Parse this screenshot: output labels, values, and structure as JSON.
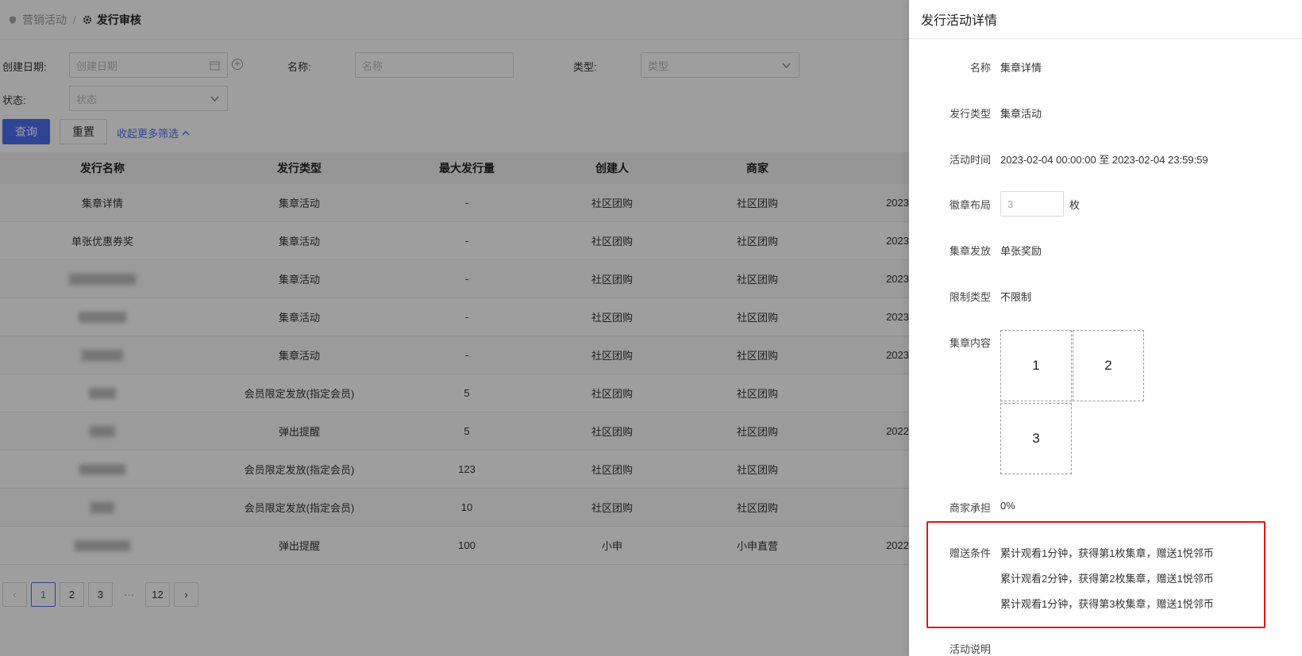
{
  "breadcrumb": {
    "parent": "营销活动",
    "current": "发行审核"
  },
  "filters": {
    "create_date_label": "创建日期:",
    "create_date_placeholder": "创建日期",
    "name_label": "名称:",
    "name_placeholder": "名称",
    "type_label": "类型:",
    "type_placeholder": "类型",
    "status_label": "状态:",
    "status_placeholder": "状态",
    "query_button": "查询",
    "reset_button": "重置",
    "collapse_link": "收起更多筛选"
  },
  "table": {
    "headers": [
      "发行名称",
      "发行类型",
      "最大发行量",
      "创建人",
      "商家",
      ""
    ],
    "rows": [
      {
        "name": "集章详情",
        "type": "集章活动",
        "max": "-",
        "creator": "社区团购",
        "merchant": "社区团购",
        "extra": "2023"
      },
      {
        "name": "单张优惠券奖",
        "type": "集章活动",
        "max": "-",
        "creator": "社区团购",
        "merchant": "社区团购",
        "extra": "2023"
      },
      {
        "name": "",
        "type": "集章活动",
        "max": "-",
        "creator": "社区团购",
        "merchant": "社区团购",
        "extra": "2023"
      },
      {
        "name": "",
        "type": "集章活动",
        "max": "-",
        "creator": "社区团购",
        "merchant": "社区团购",
        "extra": "2023"
      },
      {
        "name": "",
        "type": "集章活动",
        "max": "-",
        "creator": "社区团购",
        "merchant": "社区团购",
        "extra": "2023"
      },
      {
        "name": "",
        "type": "会员限定发放(指定会员)",
        "max": "5",
        "creator": "社区团购",
        "merchant": "社区团购",
        "extra": ""
      },
      {
        "name": "",
        "type": "弹出提醒",
        "max": "5",
        "creator": "社区团购",
        "merchant": "社区团购",
        "extra": "2022"
      },
      {
        "name": "",
        "type": "会员限定发放(指定会员)",
        "max": "123",
        "creator": "社区团购",
        "merchant": "社区团购",
        "extra": ""
      },
      {
        "name": "",
        "type": "会员限定发放(指定会员)",
        "max": "10",
        "creator": "社区团购",
        "merchant": "社区团购",
        "extra": ""
      },
      {
        "name": "",
        "type": "弹出提醒",
        "max": "100",
        "creator": "小申",
        "merchant": "小申直营",
        "extra": "2022"
      }
    ]
  },
  "pagination": {
    "prev": "‹",
    "pages": [
      "1",
      "2",
      "3"
    ],
    "ellipsis": "···",
    "last": "12",
    "next": "›",
    "current": "1"
  },
  "drawer": {
    "title": "发行活动详情",
    "fields": {
      "name_label": "名称",
      "name_value": "集章详情",
      "type_label": "发行类型",
      "type_value": "集章活动",
      "time_label": "活动时间",
      "time_value": "2023-02-04 00:00:00 至 2023-02-04 23:59:59",
      "layout_label": "徽章布局",
      "layout_value": "3",
      "layout_unit": "枚",
      "issue_label": "集章发放",
      "issue_value": "单张奖励",
      "limit_label": "限制类型",
      "limit_value": "不限制",
      "content_label": "集章内容",
      "stamps": [
        "1",
        "2",
        "3"
      ],
      "merchant_label": "商家承担",
      "merchant_value": "0%",
      "gift_label": "赠送条件",
      "gift_lines": [
        "累计观看1分钟，获得第1枚集章，赠送1悦邻币",
        "累计观看2分钟，获得第2枚集章，赠送1悦邻币",
        "累计观看1分钟，获得第3枚集章，赠送1悦邻币"
      ],
      "desc_label": "活动说明"
    }
  },
  "colors": {
    "primary": "#4e6ef2",
    "highlight": "#e01515"
  }
}
